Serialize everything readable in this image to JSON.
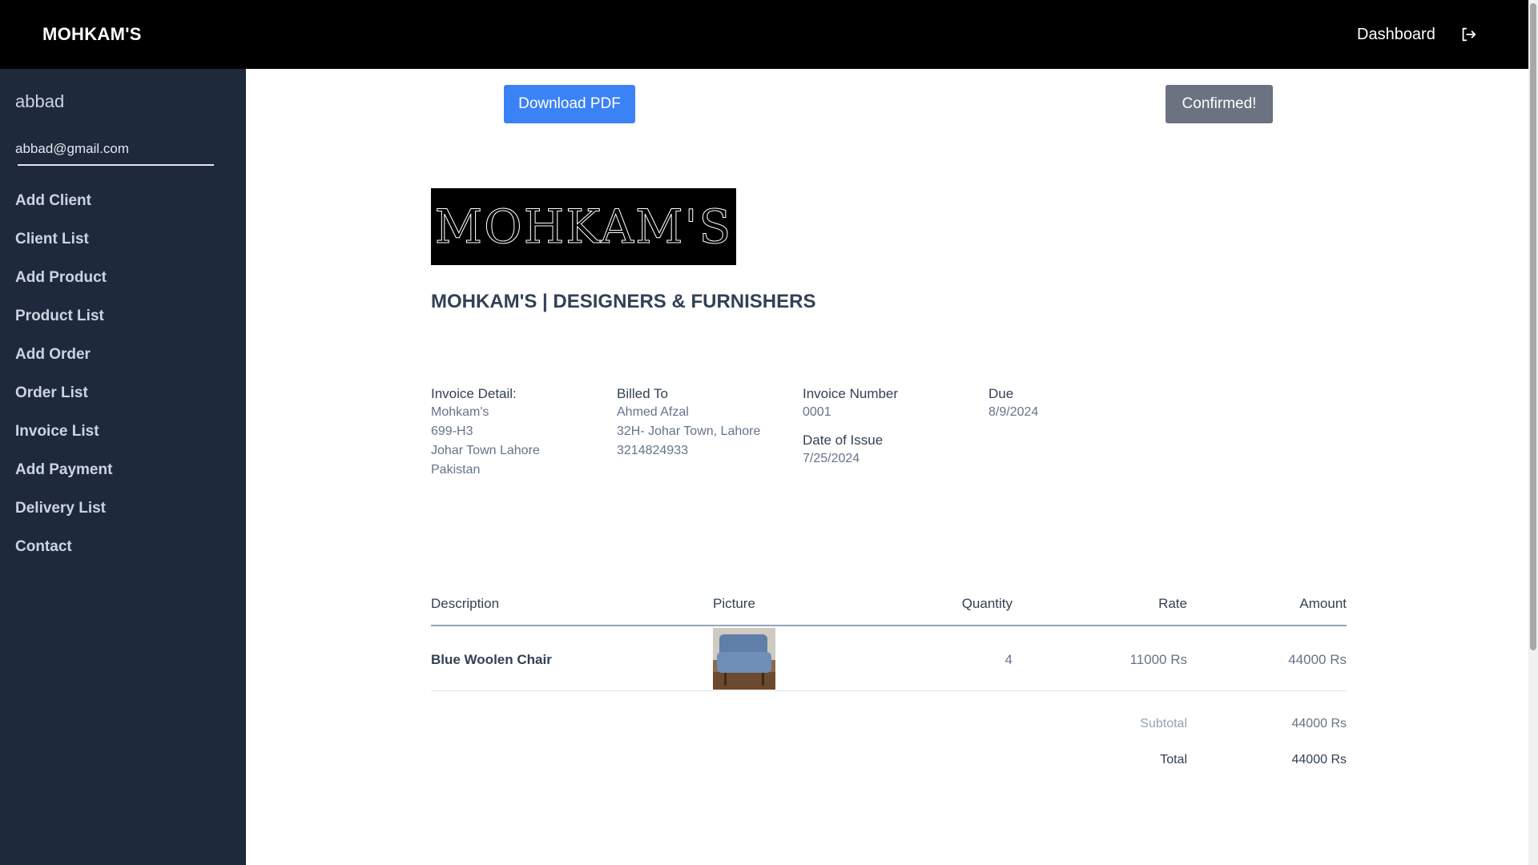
{
  "topbar": {
    "brand": "MOHKAM'S",
    "dashboard_label": "Dashboard"
  },
  "sidebar": {
    "user_name": "abbad",
    "user_email": "abbad@gmail.com",
    "items": [
      {
        "label": "Add Client"
      },
      {
        "label": "Client List"
      },
      {
        "label": "Add Product"
      },
      {
        "label": "Product List"
      },
      {
        "label": "Add Order"
      },
      {
        "label": "Order List"
      },
      {
        "label": "Invoice List"
      },
      {
        "label": "Add Payment"
      },
      {
        "label": "Delivery List"
      },
      {
        "label": "Contact"
      }
    ]
  },
  "actions": {
    "download_label": "Download PDF",
    "status_label": "Confirmed!"
  },
  "invoice": {
    "logo_text": "MOHKAM'S",
    "company_title": "MOHKAM'S | DESIGNERS & FURNISHERS",
    "detail": {
      "label": "Invoice Detail:",
      "lines": [
        "Mohkam's",
        "699-H3",
        "Johar Town Lahore",
        "Pakistan"
      ]
    },
    "billed_to": {
      "label": "Billed To",
      "lines": [
        "Ahmed Afzal",
        "32H- Johar Town, Lahore",
        "3214824933"
      ]
    },
    "number": {
      "label": "Invoice Number",
      "value": "0001"
    },
    "issue": {
      "label": "Date of Issue",
      "value": "7/25/2024"
    },
    "due": {
      "label": "Due",
      "value": "8/9/2024"
    },
    "table": {
      "headers": {
        "description": "Description",
        "picture": "Picture",
        "quantity": "Quantity",
        "rate": "Rate",
        "amount": "Amount"
      },
      "rows": [
        {
          "description": "Blue Woolen Chair",
          "quantity": "4",
          "rate": "11000 Rs",
          "amount": "44000 Rs"
        }
      ]
    },
    "subtotal": {
      "label": "Subtotal",
      "value": "44000 Rs"
    },
    "total": {
      "label": "Total",
      "value": "44000 Rs"
    }
  },
  "colors": {
    "topbar_bg": "#000000",
    "sidebar_bg": "#1e293b",
    "primary_button": "#3b82f6",
    "status_button": "#6b7280"
  }
}
